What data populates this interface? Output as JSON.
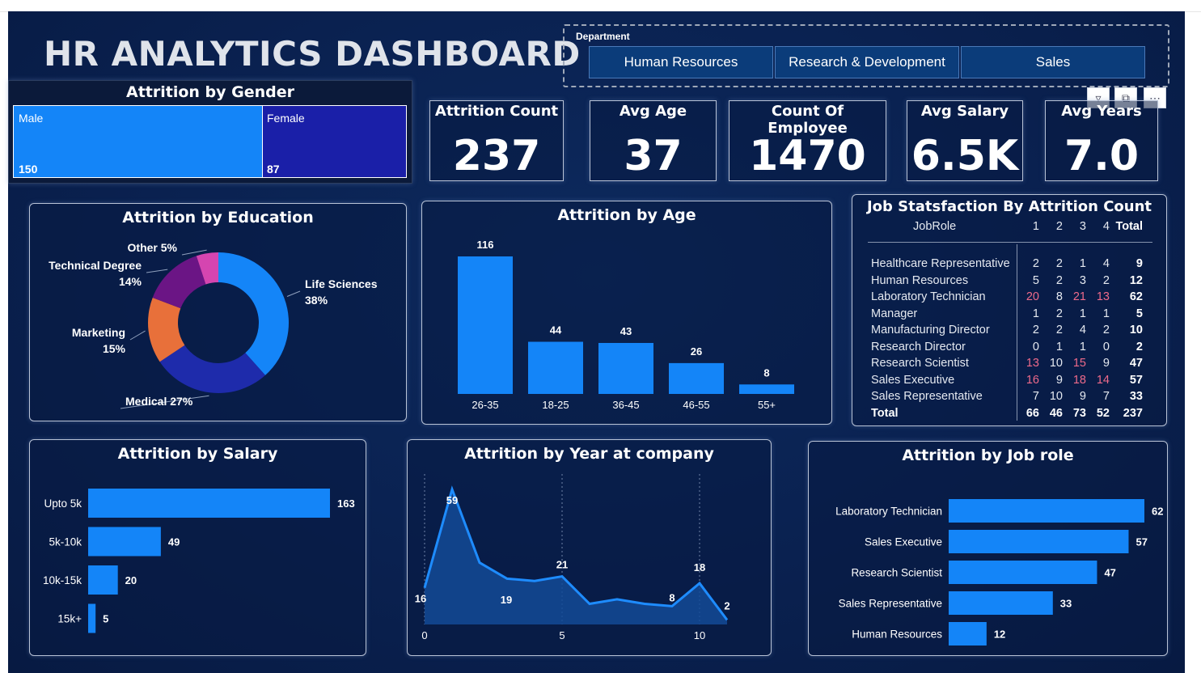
{
  "dashboard": {
    "title": "HR ANALYTICS DASHBOARD"
  },
  "slicer": {
    "label": "Department",
    "options": [
      "Human Resources",
      "Research & Development",
      "Sales"
    ]
  },
  "toolbar": {
    "icons": [
      "filter-icon",
      "focus-mode-icon",
      "more-options-icon"
    ]
  },
  "kpis": [
    {
      "label": "Attrition Count",
      "value": "237"
    },
    {
      "label": "Avg Age",
      "value": "37"
    },
    {
      "label": "Count Of Employee",
      "value": "1470"
    },
    {
      "label": "Avg Salary",
      "value": "6.5K"
    },
    {
      "label": "Avg Years",
      "value": "7.0"
    }
  ],
  "colors": {
    "primary_blue": "#1485f8",
    "dark_blue": "#1a1fa8",
    "navy": "#0a2150"
  },
  "gender": {
    "title": "Attrition by Gender",
    "items": [
      {
        "label": "Male",
        "value": "150"
      },
      {
        "label": "Female",
        "value": "87"
      }
    ]
  },
  "job_satisfaction": {
    "title": "Job Statsfaction By Attrition Count",
    "headers": [
      "JobRole",
      "1",
      "2",
      "3",
      "4",
      "Total"
    ],
    "rows": [
      [
        "Healthcare Representative",
        "2",
        "2",
        "1",
        "4",
        "9"
      ],
      [
        "Human Resources",
        "5",
        "2",
        "3",
        "2",
        "12"
      ],
      [
        "Laboratory Technician",
        "20",
        "8",
        "21",
        "13",
        "62"
      ],
      [
        "Manager",
        "1",
        "2",
        "1",
        "1",
        "5"
      ],
      [
        "Manufacturing Director",
        "2",
        "2",
        "4",
        "2",
        "10"
      ],
      [
        "Research Director",
        "0",
        "1",
        "1",
        "0",
        "2"
      ],
      [
        "Research Scientist",
        "13",
        "10",
        "15",
        "9",
        "47"
      ],
      [
        "Sales Executive",
        "16",
        "9",
        "18",
        "14",
        "57"
      ],
      [
        "Sales Representative",
        "7",
        "10",
        "9",
        "7",
        "33"
      ]
    ],
    "total": [
      "Total",
      "66",
      "46",
      "73",
      "52",
      "237"
    ]
  },
  "chart_data": [
    {
      "type": "pie",
      "title": "Attrition by Education",
      "categories": [
        "Life Sciences",
        "Medical",
        "Marketing",
        "Technical Degree",
        "Other"
      ],
      "values": [
        38,
        27,
        15,
        14,
        5
      ],
      "labels": [
        "38%",
        "27%",
        "15%",
        "14%",
        "5%"
      ],
      "colors": [
        "#1485f8",
        "#1e2bab",
        "#e8703a",
        "#6b1585",
        "#d545b0"
      ]
    },
    {
      "type": "bar",
      "title": "Attrition by Age",
      "categories": [
        "26-35",
        "18-25",
        "36-45",
        "46-55",
        "55+"
      ],
      "values": [
        116,
        44,
        43,
        26,
        8
      ]
    },
    {
      "type": "bar",
      "title": "Attrition by Salary",
      "orientation": "horizontal",
      "categories": [
        "Upto 5k",
        "5k-10k",
        "10k-15k",
        "15k+"
      ],
      "values": [
        163,
        49,
        20,
        5
      ]
    },
    {
      "type": "area",
      "title": "Attrition by Year at company",
      "x": [
        0,
        1,
        2,
        3,
        4,
        5,
        6,
        7,
        8,
        9,
        10,
        11
      ],
      "y": [
        16,
        59,
        27,
        20,
        19,
        21,
        9,
        11,
        9,
        8,
        18,
        2
      ],
      "labeled_points": [
        0,
        1,
        4,
        5,
        9,
        10,
        11
      ],
      "x_ticks": [
        0,
        5,
        10
      ]
    },
    {
      "type": "bar",
      "title": "Attrition by Job role",
      "orientation": "horizontal",
      "categories": [
        "Laboratory Technician",
        "Sales Executive",
        "Research Scientist",
        "Sales Representative",
        "Human Resources"
      ],
      "values": [
        62,
        57,
        47,
        33,
        12
      ]
    }
  ]
}
